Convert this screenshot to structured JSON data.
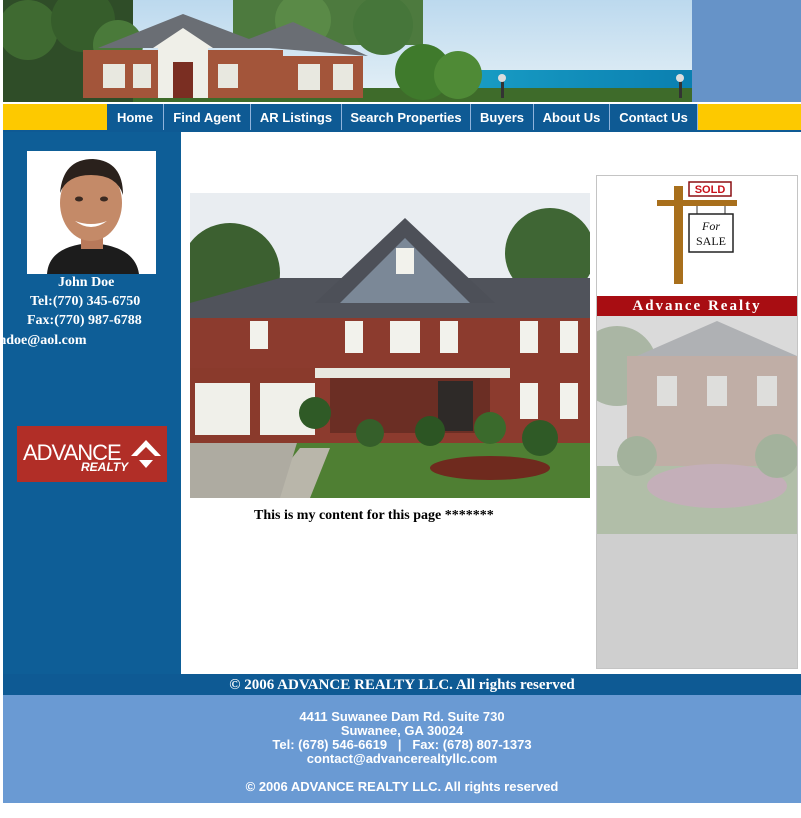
{
  "nav": {
    "items": [
      {
        "label": "Home"
      },
      {
        "label": "Find Agent"
      },
      {
        "label": "AR Listings"
      },
      {
        "label": "Search Properties"
      },
      {
        "label": "Buyers"
      },
      {
        "label": "About Us"
      },
      {
        "label": "Contact Us"
      }
    ]
  },
  "agent": {
    "name": "John  Doe",
    "tel": "Tel:(770) 345-6750",
    "fax": "Fax:(770) 987-6788",
    "email": "johndoe@aol.com"
  },
  "logo": {
    "line1": "ADVANCE",
    "line2": "REALTY"
  },
  "content": {
    "text": "This is my content for this page *******"
  },
  "sold_panel": {
    "sold": "SOLD",
    "for": "For",
    "sale": "SALE",
    "banner": "Advance  Realty"
  },
  "copyright_bar": "© 2006 ADVANCE REALTY LLC. All rights reserved",
  "footer": {
    "address1": "4411 Suwanee Dam Rd. Suite 730",
    "address2": "Suwanee, GA 30024",
    "phone": "Tel: (678) 546-6619   |   Fax: (678) 807-1373",
    "email": "contact@advancerealtyllc.com",
    "copyright": "© 2006 ADVANCE REALTY LLC. All rights reserved"
  },
  "colors": {
    "nav_blue": "#0e5a94",
    "nav_yellow": "#fdc900",
    "footer_blue": "#6a9ad3",
    "sold_red": "#a80d12"
  }
}
